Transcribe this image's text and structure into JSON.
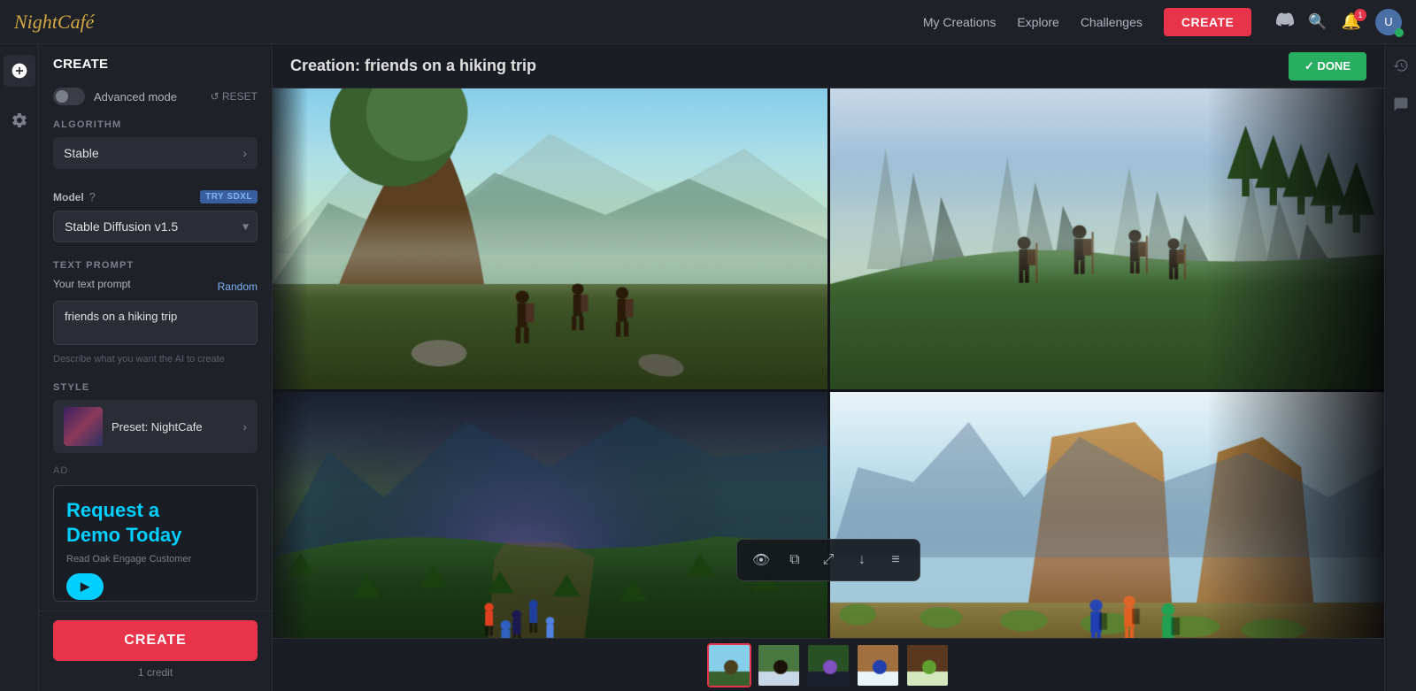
{
  "app": {
    "name": "NightCafe",
    "logo": "NightCafé"
  },
  "topnav": {
    "my_creations": "My Creations",
    "explore": "Explore",
    "challenges": "Challenges",
    "create_btn": "CREATE"
  },
  "sidebar": {
    "create_label": "CREATE",
    "advanced_mode_label": "Advanced mode",
    "reset_label": "↺ RESET",
    "algorithm_label": "ALGORITHM",
    "algorithm_value": "Stable",
    "model_label": "Model",
    "model_badge": "TRY SDXL",
    "model_value": "Stable Diffusion v1.5",
    "text_prompt_label": "TEXT PROMPT",
    "your_text_prompt": "Your text prompt",
    "random_label": "Random",
    "prompt_value": "friends on a hiking trip",
    "prompt_hint": "Describe what you want the AI to create",
    "style_label": "STYLE",
    "style_preset": "Preset: NightCafe",
    "ad_label": "AD",
    "ad_headline": "Request a\nDemo Today",
    "ad_subtext": "Read Oak Engage Customer",
    "ad_btn_label": "▶",
    "create_btn_label": "CREATE",
    "credit_text": "1 credit"
  },
  "main": {
    "creation_title": "Creation: friends on a hiking trip",
    "done_btn": "✓ DONE"
  },
  "images": {
    "grid": [
      {
        "id": 1,
        "description": "hiking group forest misty"
      },
      {
        "id": 2,
        "description": "hikers mountain overlook"
      },
      {
        "id": 3,
        "description": "group hiking trail valley"
      },
      {
        "id": 4,
        "description": "hiker mountain landscape"
      }
    ]
  },
  "toolbar": {
    "eye_icon": "👁",
    "copy_icon": "⧉",
    "expand_icon": "⤢",
    "download_icon": "↓",
    "menu_icon": "≡"
  },
  "thumbnails": [
    {
      "id": 1,
      "active": true
    },
    {
      "id": 2,
      "active": false
    },
    {
      "id": 3,
      "active": false
    },
    {
      "id": 4,
      "active": false
    },
    {
      "id": 5,
      "active": false
    }
  ]
}
